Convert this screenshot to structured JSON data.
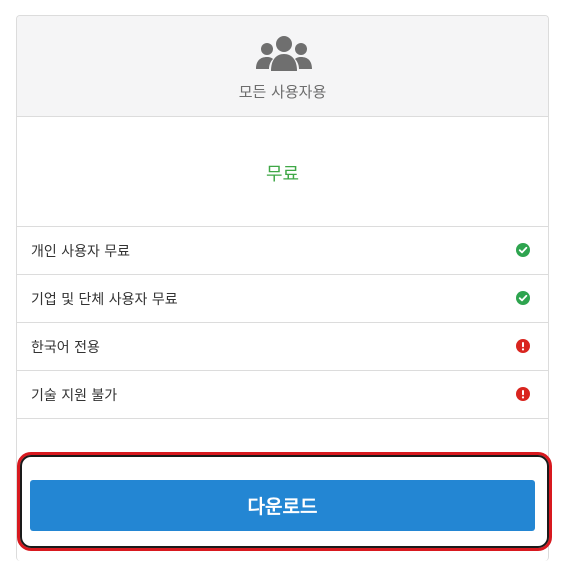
{
  "plan": {
    "header_icon": "users-group-icon",
    "title": "모든 사용자용",
    "price": "무료",
    "features": [
      {
        "label": "개인 사용자 무료",
        "status": "check-circle-icon",
        "status_color": "#2ea44f"
      },
      {
        "label": "기업 및 단체 사용자 무료",
        "status": "check-circle-icon",
        "status_color": "#2ea44f"
      },
      {
        "label": "한국어 전용",
        "status": "exclamation-circle-icon",
        "status_color": "#d9251f"
      },
      {
        "label": "기술 지원 불가",
        "status": "exclamation-circle-icon",
        "status_color": "#d9251f"
      }
    ],
    "download_label": "다운로드"
  },
  "colors": {
    "accent": "#2386d3",
    "price": "#3fa746",
    "highlight": "#d8191f",
    "header_bg": "#f5f5f6"
  }
}
